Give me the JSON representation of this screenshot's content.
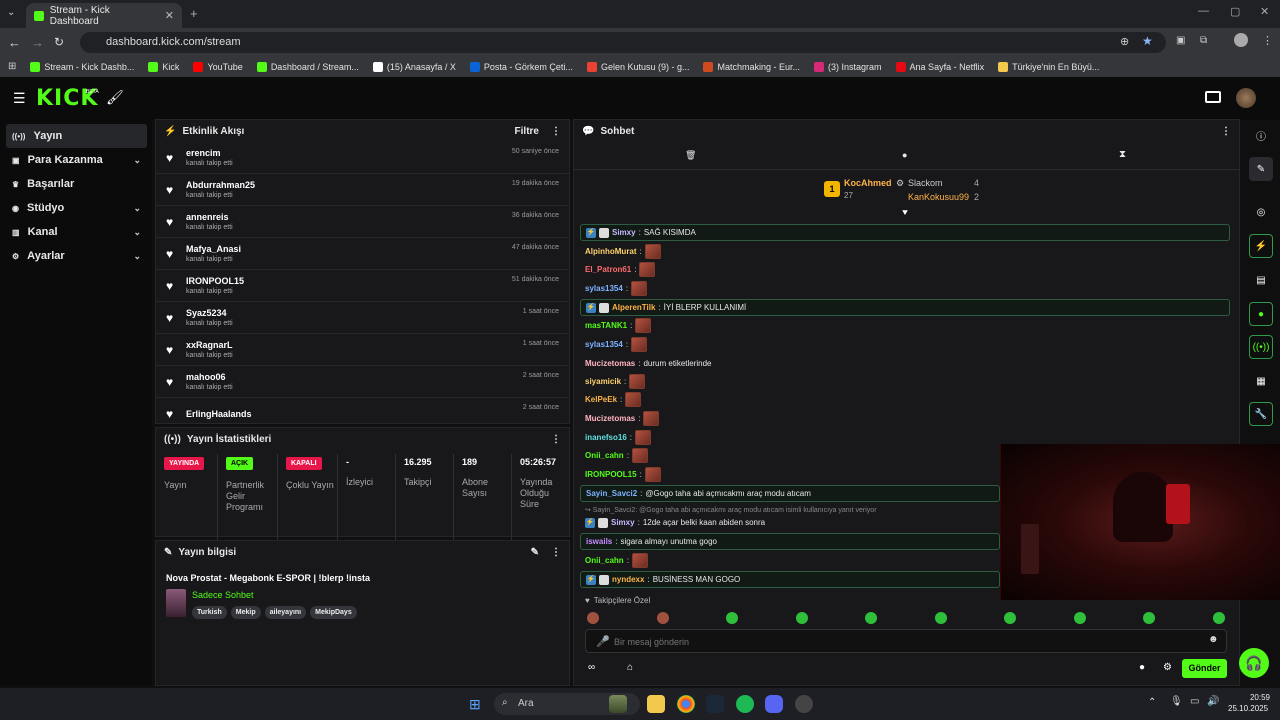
{
  "browser": {
    "tab_title": "Stream - Kick Dashboard",
    "url": "dashboard.kick.com/stream",
    "bookmarks": [
      {
        "label": "Stream - Kick Dashb...",
        "color": "#53fc18"
      },
      {
        "label": "Kick",
        "color": "#53fc18"
      },
      {
        "label": "YouTube",
        "color": "#ff0000"
      },
      {
        "label": "Dashboard / Stream...",
        "color": "#53fc18"
      },
      {
        "label": "(15) Anasayfa / X",
        "color": "#ffffff"
      },
      {
        "label": "Posta - Görkem Çeti...",
        "color": "#0a64d6"
      },
      {
        "label": "Gelen Kutusu (9) - g...",
        "color": "#ea4335"
      },
      {
        "label": "Matchmaking - Eur...",
        "color": "#d04a21"
      },
      {
        "label": "(3) Instagram",
        "color": "#d62976"
      },
      {
        "label": "Ana Sayfa - Netflix",
        "color": "#e50914"
      },
      {
        "label": "Türkiye'nin En Büyü...",
        "color": "#f2c94c"
      }
    ]
  },
  "kick": {
    "logo": "KICK",
    "beta": "BETA"
  },
  "sidebar": {
    "items": [
      {
        "label": "Yayın",
        "icon": "broadcast-icon",
        "active": true,
        "chev": false
      },
      {
        "label": "Para Kazanma",
        "icon": "money-icon",
        "chev": true
      },
      {
        "label": "Başarılar",
        "icon": "trophy-icon",
        "chev": false
      },
      {
        "label": "Stüdyo",
        "icon": "studio-icon",
        "chev": true
      },
      {
        "label": "Kanal",
        "icon": "channel-icon",
        "chev": true
      },
      {
        "label": "Ayarlar",
        "icon": "gear-icon",
        "chev": true
      }
    ]
  },
  "activity": {
    "title": "Etkinlik Akışı",
    "filter": "Filtre",
    "events": [
      {
        "name": "erencim",
        "sub": "kanalı takip etti",
        "time": "50 saniye önce"
      },
      {
        "name": "Abdurrahman25",
        "sub": "kanalı takip etti",
        "time": "19 dakika önce"
      },
      {
        "name": "annenreis",
        "sub": "kanalı takip etti",
        "time": "36 dakika önce"
      },
      {
        "name": "Mafya_Anasi",
        "sub": "kanalı takip etti",
        "time": "47 dakika önce"
      },
      {
        "name": "IRONPOOL15",
        "sub": "kanalı takip etti",
        "time": "51 dakika önce"
      },
      {
        "name": "Syaz5234",
        "sub": "kanalı takip etti",
        "time": "1 saat önce"
      },
      {
        "name": "xxRagnarL",
        "sub": "kanalı takip etti",
        "time": "1 saat önce"
      },
      {
        "name": "mahoo06",
        "sub": "kanalı takip etti",
        "time": "2 saat önce"
      },
      {
        "name": "ErlingHaalands",
        "sub": "",
        "time": "2 saat önce"
      }
    ]
  },
  "stats": {
    "title": "Yayın İstatistikleri",
    "cols": [
      {
        "badge": "YAYINDA",
        "badge_color": "#e8174a",
        "label": "Yayın"
      },
      {
        "badge": "AÇIK",
        "badge_color": "#53fc18",
        "label": "Partnerlik Gelir Programı"
      },
      {
        "badge": "KAPALI",
        "badge_color": "#e8174a",
        "label": "Çoklu Yayın"
      },
      {
        "value": "-",
        "label": "İzleyici"
      },
      {
        "value": "16.295",
        "label": "Takipçi"
      },
      {
        "value": "189",
        "label": "Abone Sayısı"
      },
      {
        "value": "05:26:57",
        "label": "Yayında Olduğu Süre"
      }
    ]
  },
  "info": {
    "title": "Yayın bilgisi",
    "stream_title": "Nova Prostat - Megabonk E-SPOR | !blerp !insta",
    "category": "Sadece Sohbet",
    "tags": [
      "Turkish",
      "Mekip",
      "aileyayını",
      "MekipDays"
    ]
  },
  "chat": {
    "title": "Sohbet",
    "leaderboard": [
      {
        "name": "KocAhmed",
        "count": "27",
        "rank": "1"
      },
      {
        "name": "Slackom",
        "count": "4"
      },
      {
        "name": "KanKokusuu99",
        "count": "2"
      }
    ],
    "messages": [
      {
        "user": "Simxy",
        "color": "#c6b9ff",
        "text": "SAĞ KISIMDA",
        "hl": true,
        "badges": true
      },
      {
        "user": "AlpinhoMurat",
        "color": "#ffd36a",
        "text": "",
        "emote": true
      },
      {
        "user": "El_Patron61",
        "color": "#ff6b6b",
        "text": "",
        "emote": true
      },
      {
        "user": "sylas1354",
        "color": "#7fb3ff",
        "text": "",
        "emote": true
      },
      {
        "user": "AlperenTilk",
        "color": "#ffb347",
        "text": "İYİ BLERP KULLANIMİ",
        "hl": true,
        "badges": true
      },
      {
        "user": "masTANK1",
        "color": "#53fc18",
        "text": "",
        "emote": true
      },
      {
        "user": "sylas1354",
        "color": "#7fb3ff",
        "text": "",
        "emote": true
      },
      {
        "user": "Mucizetomas",
        "color": "#ffb3c1",
        "text": "durum etiketlerinde"
      },
      {
        "user": "siyamicik",
        "color": "#ffd36a",
        "text": "",
        "emote": true
      },
      {
        "user": "KelPeEk",
        "color": "#ffb347",
        "text": "",
        "emote": true
      },
      {
        "user": "Mucizetomas",
        "color": "#ffb3c1",
        "text": "",
        "emote": true
      },
      {
        "user": "inanefso16",
        "color": "#5ee0e0",
        "text": "",
        "emote": true
      },
      {
        "user": "Onii_cahn",
        "color": "#53fc18",
        "text": "",
        "emote": true
      },
      {
        "user": "IRONPOOL15",
        "color": "#53fc18",
        "text": "",
        "emote": true
      },
      {
        "user": "Sayin_Savci2",
        "color": "#7fb3ff",
        "text": "@Gogo taha abi açmıcakmı araç modu atıcam",
        "hl": true
      },
      {
        "user": "",
        "color": "#999",
        "text": "↪ Sayin_Savci2: @Gogo taha abi açmıcakmı araç modu atıcam isimli kullanıcıya yanıt veriyor",
        "reply": true
      },
      {
        "user": "Simxy",
        "color": "#c6b9ff",
        "text": "12de açar belki kaan abiden sonra",
        "badges": true
      },
      {
        "user": "iswails",
        "color": "#c68bff",
        "text": "sigara almayı unutma gogo",
        "hl": true
      },
      {
        "user": "Onii_cahn",
        "color": "#53fc18",
        "text": "",
        "emote": true
      },
      {
        "user": "nyndexx",
        "color": "#ffb347",
        "text": "BUSİNESS MAN GOGO",
        "hl": true,
        "badges": true
      }
    ],
    "followers_only": "Takipçilere Özel",
    "placeholder": "Bir mesaj gönderin",
    "send": "Gönder"
  },
  "taskbar": {
    "search": "Ara",
    "time": "20:59",
    "date": "25.10.2025"
  }
}
